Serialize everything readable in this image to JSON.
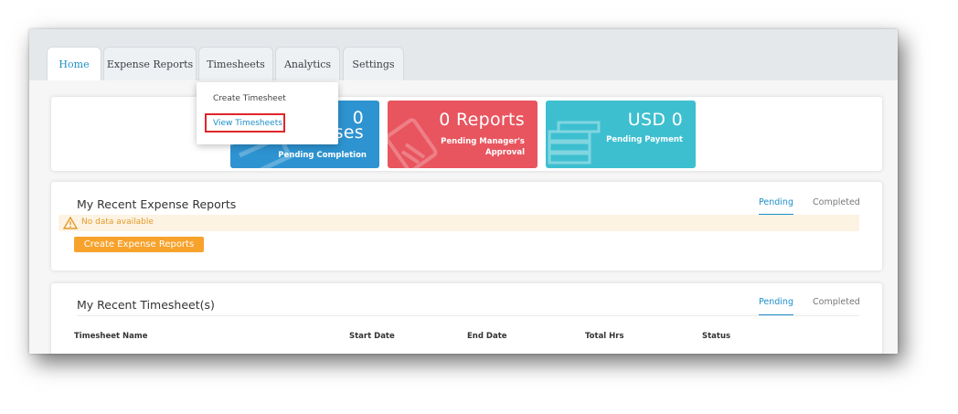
{
  "tabs": [
    {
      "label": "Home",
      "active": true
    },
    {
      "label": "Expense Reports",
      "active": false
    },
    {
      "label": "Timesheets",
      "active": false
    },
    {
      "label": "Analytics",
      "active": false
    },
    {
      "label": "Settings",
      "active": false
    }
  ],
  "dropdown": {
    "items": [
      "Create Timesheet",
      "View Timesheets"
    ]
  },
  "tiles": [
    {
      "value": "0",
      "value_partial": "ses",
      "caption": "Pending Completion",
      "color": "#2e93d1"
    },
    {
      "value": "0 Reports",
      "caption_line1": "Pending Manager's",
      "caption_line2": "Approval",
      "color": "#e8555f"
    },
    {
      "value": "USD 0",
      "caption": "Pending Payment",
      "color": "#3dbfd0"
    }
  ],
  "expense_section": {
    "title": "My Recent Expense Reports",
    "tab_pending": "Pending",
    "tab_completed": "Completed",
    "alert": "No data available",
    "button": "Create Expense Reports"
  },
  "timesheet_section": {
    "title": "My Recent Timesheet(s)",
    "tab_pending": "Pending",
    "tab_completed": "Completed",
    "columns": [
      "Timesheet Name",
      "Start Date",
      "End Date",
      "Total Hrs",
      "Status"
    ]
  },
  "colors": {
    "accent": "#1e8fc8",
    "warning": "#f7a22b",
    "highlight": "#e0262b"
  }
}
